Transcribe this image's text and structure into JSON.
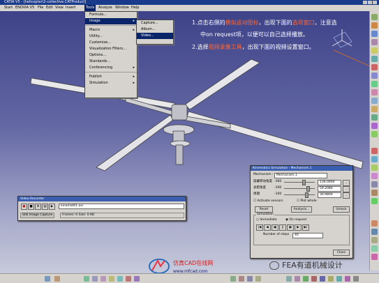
{
  "window": {
    "title": "CATIA V5 - [helicopter\\2-collective.CATProduct]"
  },
  "menubar": [
    "Start",
    "ENOVIA V5",
    "File",
    "Edit",
    "View",
    "Insert",
    "Tools",
    "Analyze",
    "Window",
    "Help"
  ],
  "tools_menu": {
    "items": [
      "Formula...",
      "Image",
      "Macro",
      "Utility...",
      "Customize...",
      "Visualization Filters...",
      "Options...",
      "Standards...",
      "Conferencing",
      "Publish",
      "Simulation"
    ],
    "image_submenu": [
      "Capture...",
      "Album...",
      "Video..."
    ]
  },
  "annotation": {
    "line1_pre": "1.点击右侧的",
    "line1_hl1": "模拟运动图标",
    "line1_mid": "，出现下面的",
    "line1_hl2": "选项窗口",
    "line1_post": "，注意选",
    "line2": "中on request项，以便可以自己选择播放。",
    "line3_pre": "2.选择",
    "line3_hl": "视频录像工具",
    "line3_post": "，出现下面的视频设置窗口。"
  },
  "video_recorder": {
    "title": "Video Recorder",
    "file": "kinemat01.avi",
    "status_mode": "Still Image Capture",
    "status_info": "Frames: 0  Size: 0  KB"
  },
  "kinematics_dialog": {
    "title": "Kinematics Simulation - Mechanism.1",
    "mechanism_label": "Mechanism :",
    "mechanism_value": "Mechanism.1",
    "commands": [
      {
        "label": "旋翼转动角度",
        "min": "-360",
        "value": "136.0000"
      },
      {
        "label": "总距角度",
        "min": "-100",
        "value": "59.2080"
      },
      {
        "label": "周期",
        "min": "-100",
        "value": "30.9800"
      }
    ],
    "check1": "Activate sensors",
    "check2": "Plot whole",
    "reset_button": "Reset",
    "analysis_button": "Analysis...",
    "unlock_button": "Unlock",
    "simulation_title": "Simulation",
    "immediate": "Immediate",
    "on_request": "On request",
    "steps_label": "Number of steps",
    "steps_value": "40",
    "close_button": "Close"
  },
  "branding": {
    "site_name": "仿真CAD在线网",
    "site_url": "www.mfcad.com",
    "watermark": "FEA有道机械设计"
  }
}
